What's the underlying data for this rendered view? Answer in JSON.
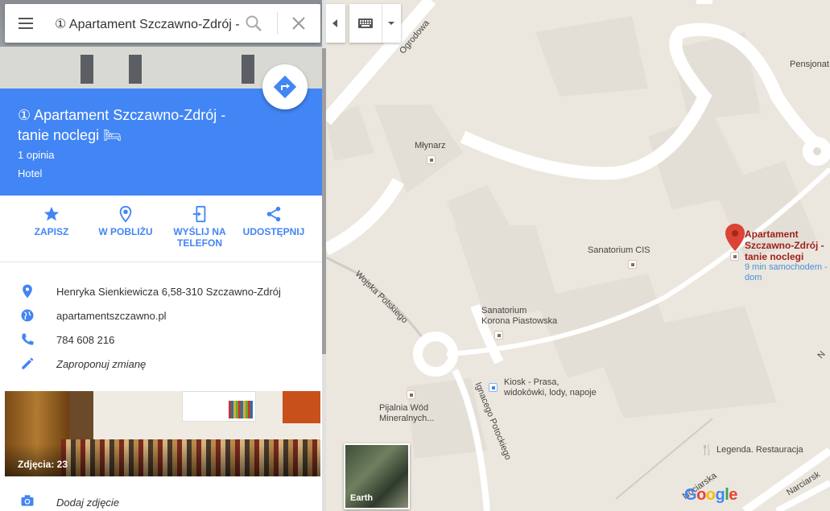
{
  "search": {
    "value": "① Apartament Szczawno-Zdrój - t"
  },
  "place": {
    "title": "① Apartament Szczawno-Zdrój - tanie noclegi 🛏",
    "reviews": "1 opinia",
    "category": "Hotel",
    "route_label": "Wyznacz trasę"
  },
  "actions": [
    {
      "label": "ZAPISZ",
      "icon": "star-icon"
    },
    {
      "label": "W POBLIŻU",
      "icon": "nearby-icon"
    },
    {
      "label": "WYŚLIJ NA TELEFON",
      "icon": "send-to-phone-icon"
    },
    {
      "label": "UDOSTĘPNIJ",
      "icon": "share-icon"
    }
  ],
  "info": {
    "address": "Henryka Sienkiewicza 6,58-310 Szczawno-Zdrój",
    "website": "apartamentszczawno.pl",
    "phone": "784 608 216",
    "suggest_edit": "Zaproponuj zmianę"
  },
  "photos": {
    "count_label": "Zdjęcia: 23"
  },
  "add_photo": "Dodaj zdjęcie",
  "map": {
    "labels": {
      "ogrodowa": "Ogrodowa",
      "pensjonat": "Pensjonat",
      "mlynarz": "Młynarz",
      "sanatorium_cis": "Sanatorium CIS",
      "sanatorium_korona_1": "Sanatorium",
      "sanatorium_korona_2": "Korona Piastowska",
      "wojska": "Wojska Polskiego",
      "kiosk_1": "Kiosk - Prasa,",
      "kiosk_2": "widokówki, lody, napoje",
      "pijalnia_1": "Pijalnia Wód",
      "pijalnia_2": "Mineralnych...",
      "ignacego": "Ignacego Potockiego",
      "legenda": "Legenda. Restauracja",
      "kosciuszki": "Nociarska",
      "narciarska": "Narciarsk",
      "n_edge": "N"
    },
    "pin": {
      "name": "Apartament Szczawno-Zdrój - tanie noclegi",
      "drive": "9 min samochodem - dom"
    },
    "earth_label": "Earth",
    "google_logo": "Google"
  },
  "colors": {
    "accent": "#4285f4",
    "pin": "#db4437",
    "map_bg": "#ebe7de",
    "road": "#ffffff"
  }
}
